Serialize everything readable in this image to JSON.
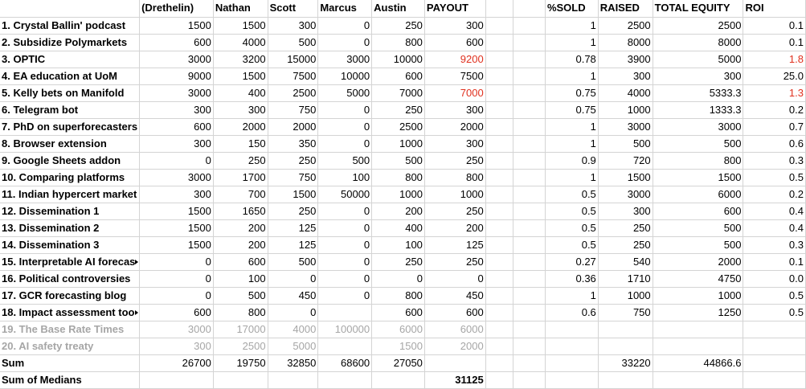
{
  "headers": {
    "a": "",
    "b": "(Drethelin)",
    "c": "Nathan",
    "d": "Scott",
    "e": "Marcus",
    "f": "Austin",
    "g": "PAYOUT",
    "h": "",
    "i": "",
    "j": "%SOLD",
    "k": "RAISED",
    "l": "TOTAL EQUITY",
    "m": "ROI"
  },
  "rows": [
    {
      "label": "1. Crystal Ballin' podcast",
      "b": "1500",
      "c": "1500",
      "d": "300",
      "e": "0",
      "f": "250",
      "g": "300",
      "j": "1",
      "k": "2500",
      "l": "2500",
      "m": "0.1"
    },
    {
      "label": "2. Subsidize Polymarkets",
      "b": "600",
      "c": "4000",
      "d": "500",
      "e": "0",
      "f": "800",
      "g": "600",
      "j": "1",
      "k": "8000",
      "l": "8000",
      "m": "0.1"
    },
    {
      "label": "3. OPTIC",
      "b": "3000",
      "c": "3200",
      "d": "15000",
      "e": "3000",
      "f": "10000",
      "g": "9200",
      "j": "0.78",
      "k": "3900",
      "l": "5000",
      "m": "1.8"
    },
    {
      "label": "4. EA education at UoM",
      "b": "9000",
      "c": "1500",
      "d": "7500",
      "e": "10000",
      "f": "600",
      "g": "7500",
      "j": "1",
      "k": "300",
      "l": "300",
      "m": "25.0"
    },
    {
      "label": "5. Kelly bets on Manifold",
      "b": "3000",
      "c": "400",
      "d": "2500",
      "e": "5000",
      "f": "7000",
      "g": "7000",
      "j": "0.75",
      "k": "4000",
      "l": "5333.3",
      "m": "1.3"
    },
    {
      "label": "6. Telegram bot",
      "b": "300",
      "c": "300",
      "d": "750",
      "e": "0",
      "f": "250",
      "g": "300",
      "j": "0.75",
      "k": "1000",
      "l": "1333.3",
      "m": "0.2"
    },
    {
      "label": "7. PhD on superforecasters",
      "b": "600",
      "c": "2000",
      "d": "2000",
      "e": "0",
      "f": "2500",
      "g": "2000",
      "j": "1",
      "k": "3000",
      "l": "3000",
      "m": "0.7"
    },
    {
      "label": "8. Browser extension",
      "b": "300",
      "c": "150",
      "d": "350",
      "e": "0",
      "f": "1000",
      "g": "300",
      "j": "1",
      "k": "500",
      "l": "500",
      "m": "0.6"
    },
    {
      "label": "9. Google Sheets addon",
      "b": "0",
      "c": "250",
      "d": "250",
      "e": "500",
      "f": "500",
      "g": "250",
      "j": "0.9",
      "k": "720",
      "l": "800",
      "m": "0.3"
    },
    {
      "label": "10. Comparing platforms",
      "b": "3000",
      "c": "1700",
      "d": "750",
      "e": "100",
      "f": "800",
      "g": "800",
      "j": "1",
      "k": "1500",
      "l": "1500",
      "m": "0.5"
    },
    {
      "label": "11. Indian hypercert market",
      "b": "300",
      "c": "700",
      "d": "1500",
      "e": "50000",
      "f": "1000",
      "g": "1000",
      "j": "0.5",
      "k": "3000",
      "l": "6000",
      "m": "0.2"
    },
    {
      "label": "12. Dissemination 1",
      "b": "1500",
      "c": "1650",
      "d": "250",
      "e": "0",
      "f": "200",
      "g": "250",
      "j": "0.5",
      "k": "300",
      "l": "600",
      "m": "0.4"
    },
    {
      "label": "13. Dissemination 2",
      "b": "1500",
      "c": "200",
      "d": "125",
      "e": "0",
      "f": "400",
      "g": "200",
      "j": "0.5",
      "k": "250",
      "l": "500",
      "m": "0.4"
    },
    {
      "label": "14. Dissemination 3",
      "b": "1500",
      "c": "200",
      "d": "125",
      "e": "0",
      "f": "100",
      "g": "125",
      "j": "0.5",
      "k": "250",
      "l": "500",
      "m": "0.3"
    },
    {
      "label": "15. Interpretable AI forecas",
      "b": "0",
      "c": "600",
      "d": "500",
      "e": "0",
      "f": "250",
      "g": "250",
      "j": "0.27",
      "k": "540",
      "l": "2000",
      "m": "0.1"
    },
    {
      "label": "16. Political controversies",
      "b": "0",
      "c": "100",
      "d": "0",
      "e": "0",
      "f": "0",
      "g": "0",
      "j": "0.36",
      "k": "1710",
      "l": "4750",
      "m": "0.0"
    },
    {
      "label": "17. GCR forecasting blog",
      "b": "0",
      "c": "500",
      "d": "450",
      "e": "0",
      "f": "800",
      "g": "450",
      "j": "1",
      "k": "1000",
      "l": "1000",
      "m": "0.5"
    },
    {
      "label": "18. Impact assessment too",
      "b": "600",
      "c": "800",
      "d": "0",
      "e": "",
      "f": "600",
      "g": "600",
      "j": "0.6",
      "k": "750",
      "l": "1250",
      "m": "0.5"
    },
    {
      "label": "19. The Base Rate Times",
      "b": "3000",
      "c": "17000",
      "d": "4000",
      "e": "100000",
      "f": "6000",
      "g": "6000",
      "j": "",
      "k": "",
      "l": "",
      "m": ""
    },
    {
      "label": "20. AI safety treaty",
      "b": "300",
      "c": "2500",
      "d": "5000",
      "e": "",
      "f": "1500",
      "g": "2000",
      "j": "",
      "k": "",
      "l": "",
      "m": ""
    },
    {
      "label": "Sum",
      "b": "26700",
      "c": "19750",
      "d": "32850",
      "e": "68600",
      "f": "27050",
      "g": "",
      "j": "",
      "k": "33220",
      "l": "44866.6",
      "m": ""
    },
    {
      "label": "Sum of Medians",
      "b": "",
      "c": "",
      "d": "",
      "e": "",
      "f": "",
      "g": "31125",
      "j": "",
      "k": "",
      "l": "",
      "m": ""
    }
  ],
  "red_color": "#e0301e",
  "grey_color": "#a6a6a6"
}
